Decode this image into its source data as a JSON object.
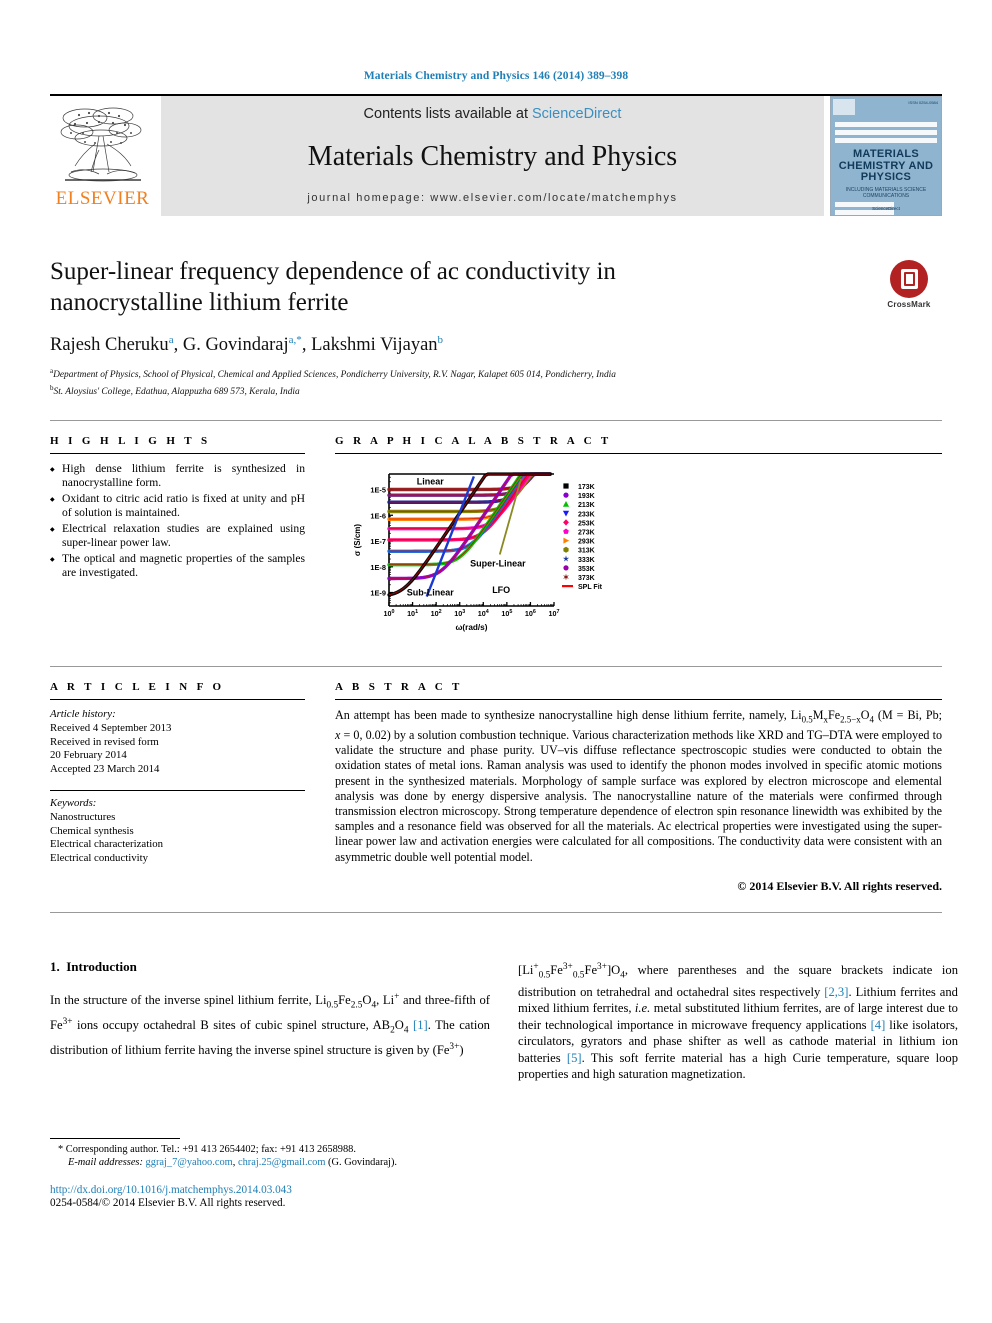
{
  "running_head": "Materials Chemistry and Physics 146 (2014) 389–398",
  "masthead": {
    "contents_prefix": "Contents lists available at ",
    "sciencedirect": "ScienceDirect",
    "journal_title": "Materials Chemistry and Physics",
    "homepage": "journal homepage: www.elsevier.com/locate/matchemphys",
    "publisher": "ELSEVIER",
    "cover": {
      "title_line1": "MATERIALS",
      "title_line2": "CHEMISTRY AND",
      "title_line3": "PHYSICS",
      "subtitle": "INCLUDING MATERIALS SCIENCE COMMUNICATIONS",
      "footer": "ScienceDirect"
    }
  },
  "crossmark": {
    "label": "CrossMark"
  },
  "article": {
    "title": "Super-linear frequency dependence of ac conductivity in nanocrystalline lithium ferrite",
    "authors_plain": "Rajesh Cheruku a, G. Govindaraj a,*, Lakshmi Vijayan b",
    "authors": [
      {
        "name": "Rajesh Cheruku",
        "marks": "a"
      },
      {
        "name": "G. Govindaraj",
        "marks": "a,*"
      },
      {
        "name": "Lakshmi Vijayan",
        "marks": "b"
      }
    ],
    "affiliations": [
      {
        "mark": "a",
        "text": "Department of Physics, School of Physical, Chemical and Applied Sciences, Pondicherry University, R.V. Nagar, Kalapet 605 014, Pondicherry, India"
      },
      {
        "mark": "b",
        "text": "St. Aloysius' College, Edathua, Alappuzha 689 573, Kerala, India"
      }
    ]
  },
  "highlights": {
    "heading": "H I G H L I G H T S",
    "items": [
      "High dense lithium ferrite is synthesized in nanocrystalline form.",
      "Oxidant to citric acid ratio is fixed at unity and pH of solution is maintained.",
      "Electrical relaxation studies are explained using super-linear power law.",
      "The optical and magnetic properties of the samples are investigated."
    ]
  },
  "graphical_abstract": {
    "heading": "G R A P H I C A L   A B S T R A C T"
  },
  "chart_data": {
    "type": "line",
    "title": "",
    "xlabel": "ω(rad/s)",
    "ylabel": "σ (S/cm)",
    "xscale": "log",
    "yscale": "log",
    "xlim": [
      1,
      10000000
    ],
    "ylim": [
      3e-10,
      4e-05
    ],
    "xticks": [
      "10⁰",
      "10¹",
      "10²",
      "10³",
      "10⁴",
      "10⁵",
      "10⁶",
      "10⁷"
    ],
    "yticks": [
      "1E-9",
      "1E-8",
      "1E-7",
      "1E-6",
      "1E-5"
    ],
    "grid": false,
    "legend_position": "right",
    "annotations": [
      {
        "text": "Linear",
        "x": 0.25,
        "y": 0.08
      },
      {
        "text": "Sub-Linear",
        "x": 0.25,
        "y": 0.92
      },
      {
        "text": "Super-Linear",
        "x": 0.66,
        "y": 0.7
      },
      {
        "text": "LFO",
        "x": 0.68,
        "y": 0.9
      }
    ],
    "legend": [
      {
        "label": "173K",
        "color": "#000000",
        "marker": "square"
      },
      {
        "label": "193K",
        "color": "#8800cc",
        "marker": "circle"
      },
      {
        "label": "213K",
        "color": "#00c000",
        "marker": "triangle-up"
      },
      {
        "label": "233K",
        "color": "#1a1aff",
        "marker": "triangle-down"
      },
      {
        "label": "253K",
        "color": "#ff0066",
        "marker": "diamond"
      },
      {
        "label": "273K",
        "color": "#ff00cc",
        "marker": "pentagon"
      },
      {
        "label": "293K",
        "color": "#ff8000",
        "marker": "triangle-right"
      },
      {
        "label": "313K",
        "color": "#808000",
        "marker": "hexagon"
      },
      {
        "label": "333K",
        "color": "#1a3a99",
        "marker": "star"
      },
      {
        "label": "353K",
        "color": "#9900aa",
        "marker": "circle-cross"
      },
      {
        "label": "373K",
        "color": "#8b1a1a",
        "marker": "star6"
      },
      {
        "label": "SPL Fit",
        "color": "#ff0000",
        "marker": "line"
      }
    ],
    "series": [
      {
        "name": "173K",
        "color": "#8b1a1a",
        "plateau": 1e-05,
        "onset_decade": 5.8
      },
      {
        "name": "193K",
        "color": "#6a1a7a",
        "plateau": 6e-06,
        "onset_decade": 5.6
      },
      {
        "name": "213K",
        "color": "#1a1a8b",
        "plateau": 3.2e-06,
        "onset_decade": 5.3
      },
      {
        "name": "233K",
        "color": "#808000",
        "plateau": 1.4e-06,
        "onset_decade": 5.0
      },
      {
        "name": "253K",
        "color": "#ff8000",
        "plateau": 7e-07,
        "onset_decade": 4.7
      },
      {
        "name": "273K",
        "color": "#ff00cc",
        "plateau": 3e-07,
        "onset_decade": 4.4
      },
      {
        "name": "293K",
        "color": "#ff0066",
        "plateau": 1.1e-07,
        "onset_decade": 4.0
      },
      {
        "name": "313K",
        "color": "#1a66d6",
        "plateau": 4e-08,
        "onset_decade": 3.5
      },
      {
        "name": "333K",
        "color": "#00c000",
        "plateau": 1.2e-08,
        "onset_decade": 3.0
      },
      {
        "name": "353K",
        "color": "#8800cc",
        "plateau": 3.5e-09,
        "onset_decade": 2.2
      },
      {
        "name": "373K",
        "color": "#000000",
        "plateau": 7e-10,
        "onset_decade": 0.6
      }
    ]
  },
  "article_info": {
    "heading": "A R T I C L E   I N F O",
    "history_label": "Article history:",
    "history": [
      "Received 4 September 2013",
      "Received in revised form",
      "20 February 2014",
      "Accepted 23 March 2014"
    ],
    "keywords_label": "Keywords:",
    "keywords": [
      "Nanostructures",
      "Chemical synthesis",
      "Electrical characterization",
      "Electrical conductivity"
    ]
  },
  "abstract": {
    "heading": "A B S T R A C T",
    "text_part1": "An attempt has been made to synthesize nanocrystalline high dense lithium ferrite, namely, Li",
    "text_full": "An attempt has been made to synthesize nanocrystalline high dense lithium ferrite, namely, Li0.5MxFe2.5−xO4 (M = Bi, Pb; x = 0, 0.02) by a solution combustion technique. Various characterization methods like XRD and TG–DTA were employed to validate the structure and phase purity. UV–vis diffuse reflectance spectroscopic studies were conducted to obtain the oxidation states of metal ions. Raman analysis was used to identify the phonon modes involved in specific atomic motions present in the synthesized materials. Morphology of sample surface was explored by electron microscope and elemental analysis was done by energy dispersive analysis. The nanocrystalline nature of the materials were confirmed through transmission electron microscopy. Strong temperature dependence of electron spin resonance linewidth was exhibited by the samples and a resonance field was observed for all the materials. Ac electrical properties were investigated using the super-linear power law and activation energies were calculated for all compositions. The conductivity data were consistent with an asymmetric double well potential model.",
    "copyright": "© 2014 Elsevier B.V. All rights reserved."
  },
  "body": {
    "section_number": "1.",
    "section_title": "Introduction",
    "col1_para": "In the structure of the inverse spinel lithium ferrite, Li0.5Fe2.5O4, Li+ and three-fifth of Fe3+ ions occupy octahedral B sites of cubic spinel structure, AB2O4 [1]. The cation distribution of lithium ferrite having the inverse spinel structure is given by (Fe3+)",
    "col2_para": "[Li+0.5Fe3+0.5Fe3+]O4, where parentheses and the square brackets indicate ion distribution on tetrahedral and octahedral sites respectively [2,3]. Lithium ferrites and mixed lithium ferrites, i.e. metal substituted lithium ferrites, are of large interest due to their technological importance in microwave frequency applications [4] like isolators, circulators, gyrators and phase shifter as well as cathode material in lithium ion batteries [5]. This soft ferrite material has a high Curie temperature, square loop properties and high saturation magnetization."
  },
  "footnotes": {
    "corresponding": "* Corresponding author. Tel.: +91 413 2654402; fax: +91 413 2658988.",
    "email_label": "E-mail addresses:",
    "email1": "ggraj_7@yahoo.com",
    "email2": "chraj.25@gmail.com",
    "email_suffix": "(G. Govindaraj).",
    "doi": "http://dx.doi.org/10.1016/j.matchemphys.2014.03.043",
    "issn": "0254-0584/© 2014 Elsevier B.V. All rights reserved."
  },
  "colors": {
    "link": "#1f7fb6",
    "brand_orange": "#f08020",
    "band_gray": "#e3e3e3",
    "crossmark_red": "#b22222"
  }
}
